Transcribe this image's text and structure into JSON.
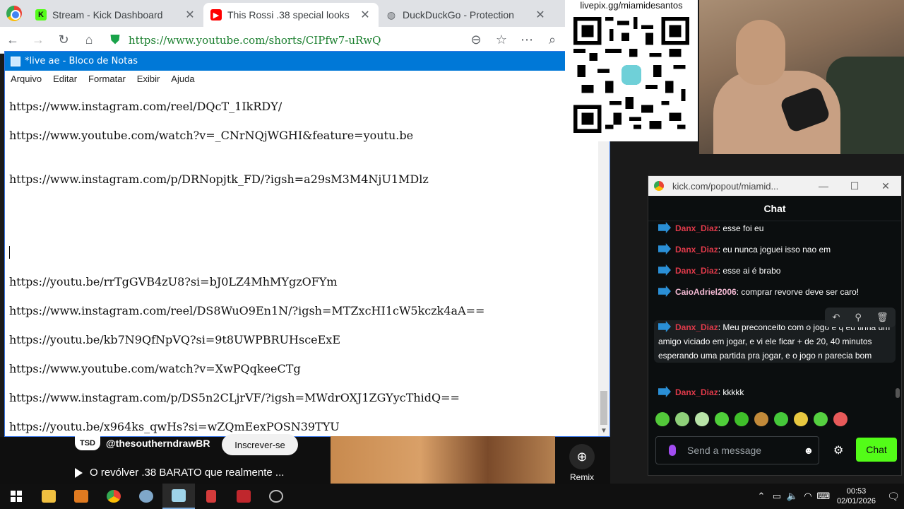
{
  "browser": {
    "tabs": [
      {
        "title": "Stream - Kick Dashboard",
        "favicon": "kick-icon",
        "color": "#111111"
      },
      {
        "title": "This Rossi .38 special looks",
        "favicon": "youtube-icon",
        "color": "#ff0000"
      },
      {
        "title": "DuckDuckGo - Protection",
        "favicon": "globe-icon",
        "color": "#5f6368"
      }
    ],
    "url": "https://www.youtube.com/shorts/CIPfw7-uRwQ"
  },
  "notepad": {
    "title": "*live ae - Bloco de Notas",
    "menu": [
      "Arquivo",
      "Editar",
      "Formatar",
      "Exibir",
      "Ajuda"
    ],
    "lines": [
      "https://www.instagram.com/reel/DQcT_1IkRDY/",
      "https://www.youtube.com/watch?v=_CNrNQjWGHI&feature=youtu.be",
      "https://www.instagram.com/p/DRNopjtk_FD/?igsh=a29sM3M4NjU1MDlz",
      "https://youtu.be/rrTgGVB4zU8?si=bJ0LZ4MhMYgzOFYm",
      "https://www.instagram.com/reel/DS8WuO9En1N/?igsh=MTZxcHI1cW5kczk4aA==",
      "https://youtu.be/kb7N9QfNpVQ?si=9t8UWPBRUHsceExE",
      "https://www.youtube.com/watch?v=XwPQqkeeCTg",
      "https://www.instagram.com/p/DS5n2CLjrVF/?igsh=MWdrOXJ1ZGYycThidQ==",
      "https://youtu.be/x964ks_qwHs?si=wZQmEexPOSN39TYU"
    ]
  },
  "video": {
    "channel_badge": "TSD",
    "channel": "@thesoutherndrawBR",
    "subscribe": "Inscrever-se",
    "title": "O revólver .38 BARATO que realmente ...",
    "remix": "Remix"
  },
  "livepix": {
    "url": "livepix.gg/miamidesantos"
  },
  "chat": {
    "window_url": "kick.com/popout/miamid...",
    "header": "Chat",
    "messages": [
      {
        "user": "Danx_Diaz",
        "text": ": esse foi eu",
        "style": "red"
      },
      {
        "user": "Danx_Diaz",
        "text": ": eu nunca joguei isso nao em",
        "style": "red"
      },
      {
        "user": "Danx_Diaz",
        "text": ": esse ai é brabo",
        "style": "red"
      },
      {
        "user": "CaioAdriel2006",
        "text": ": comprar revorve deve ser caro!",
        "style": "pink"
      },
      {
        "user": "Danx_Diaz",
        "text": ": Meu preconceito com o jogo é q eu tinha um amigo viciado em jogar, e vi ele ficar + de 20, 40 minutos esperando uma partida pra jogar, e o jogo n parecia bom",
        "style": "red"
      },
      {
        "user": "Danx_Diaz",
        "text": ": kkkkk",
        "style": "red"
      }
    ],
    "input_placeholder": "Send a message",
    "send_label": "Chat",
    "accent": "#53fc18"
  },
  "taskbar": {
    "time": "00:53",
    "date": "02/01/2026"
  }
}
